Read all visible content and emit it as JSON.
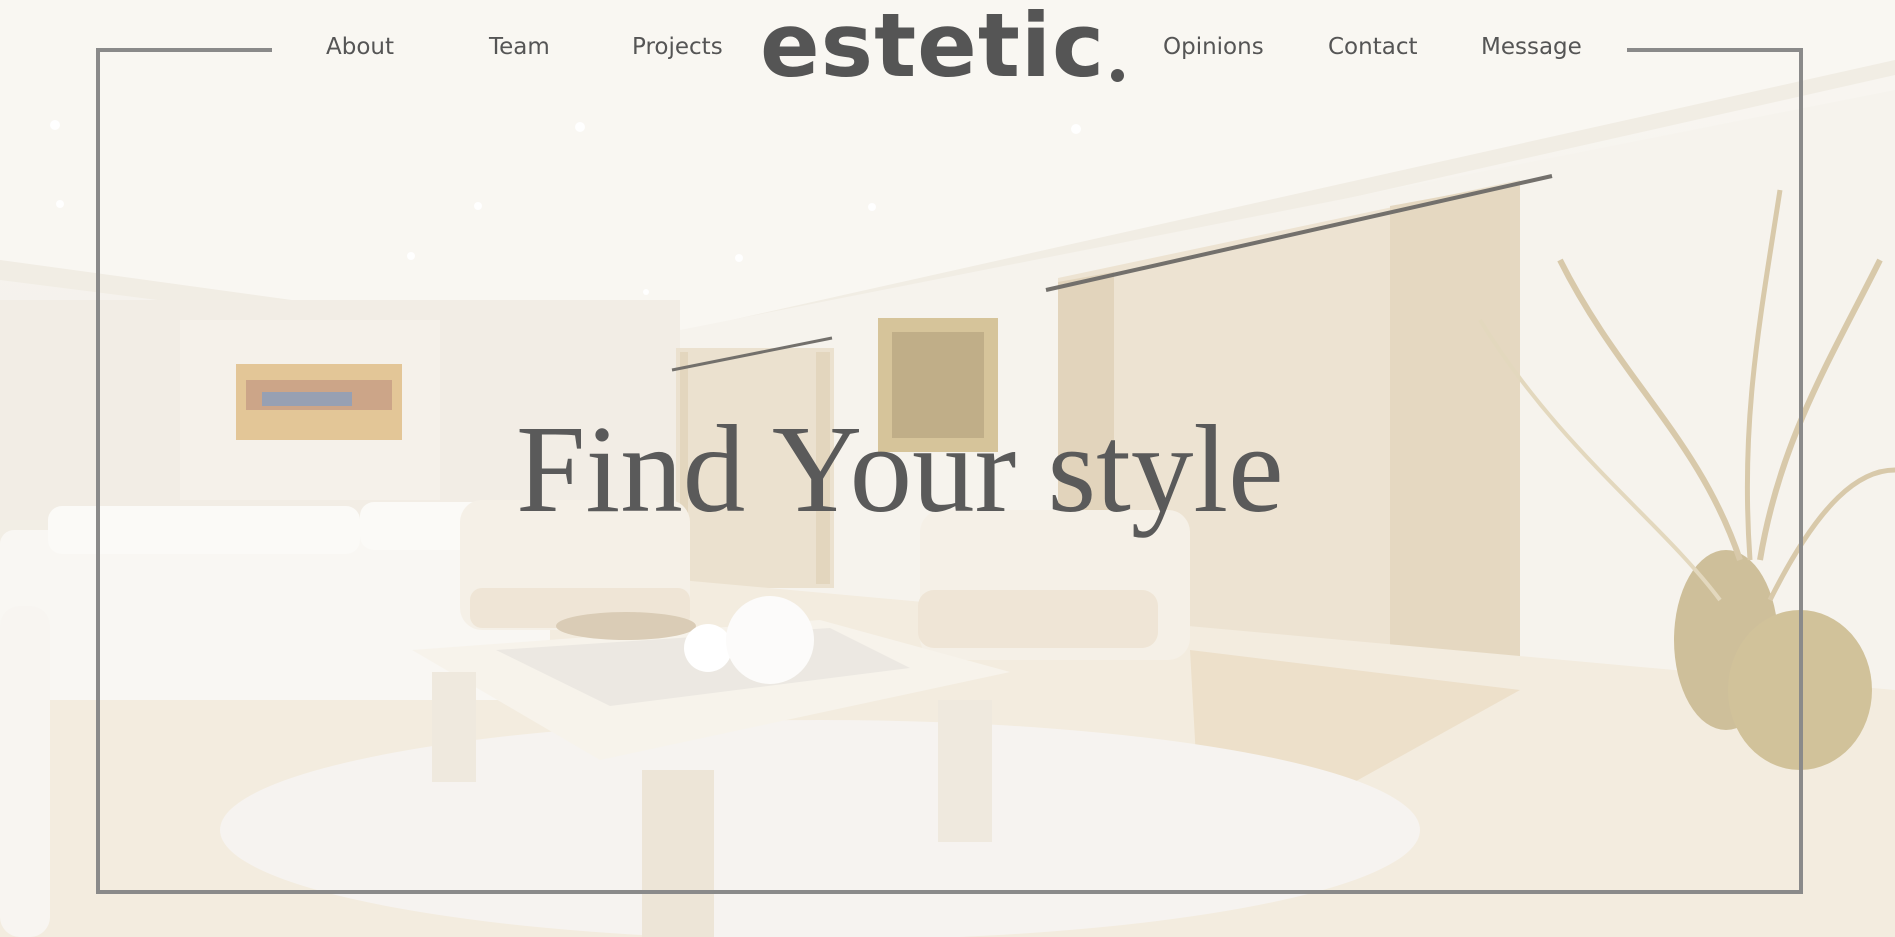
{
  "nav": {
    "left": [
      {
        "label": "About"
      },
      {
        "label": "Team"
      },
      {
        "label": "Projects"
      }
    ],
    "right": [
      {
        "label": "Opinions"
      },
      {
        "label": "Contact"
      },
      {
        "label": "Message"
      }
    ]
  },
  "brand": {
    "name": "estetic"
  },
  "hero": {
    "title": "Find Your style"
  },
  "colors": {
    "text": "#555555",
    "frame": "#8a8a8a",
    "background": "#f2eee6",
    "accent_gold": "#c9b48a"
  }
}
